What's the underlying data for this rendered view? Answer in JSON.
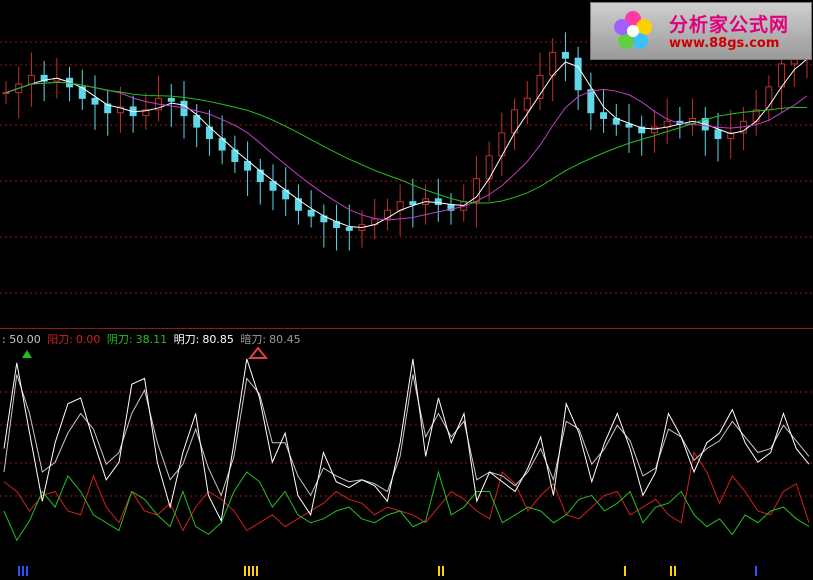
{
  "legend": {
    "value_prefix": ": 50.00",
    "yang_label": "阳刀:",
    "yang_value": "0.00",
    "yin_label": "阴刀:",
    "yin_value": "38.11",
    "ming_label": "明刀:",
    "ming_value": "80.85",
    "an_label": "暗刀:",
    "an_value": "80.45"
  },
  "logo": {
    "title": "分析家公式网",
    "url": "www.88gs.com"
  },
  "colors": {
    "up": "#c03030",
    "down": "#5fd8e8",
    "ma_short": "#ffffff",
    "ma_mid": "#c040c0",
    "ma_long": "#20c020",
    "yang": "#d02020",
    "yin": "#20c020",
    "ming": "#ffffff",
    "an": "#c8c8c8",
    "grid": "#a01010"
  },
  "chart_data": [
    {
      "type": "candlestick",
      "title": "",
      "ylim": [
        0,
        100
      ],
      "series": [
        {
          "name": "",
          "kind": "close",
          "values": [
            74,
            77,
            80,
            78,
            79,
            76,
            72,
            70,
            67,
            69,
            66,
            68,
            72,
            71,
            66,
            62,
            58,
            54,
            50,
            47,
            43,
            40,
            37,
            33,
            31,
            29,
            27,
            26,
            28,
            30,
            33,
            36,
            35,
            37,
            35,
            33,
            36,
            44,
            52,
            60,
            68,
            72,
            80,
            88,
            86,
            75,
            67,
            65,
            63,
            62,
            60,
            62,
            64,
            63,
            65,
            61,
            58,
            60,
            64,
            68,
            76,
            84,
            86,
            87
          ]
        }
      ]
    },
    {
      "type": "line",
      "title": "",
      "ylim": [
        0,
        100
      ],
      "series": [
        {
          "name": "明刀",
          "values": [
            52,
            96,
            60,
            25,
            55,
            75,
            78,
            56,
            36,
            45,
            85,
            88,
            45,
            22,
            50,
            70,
            28,
            15,
            55,
            98,
            78,
            45,
            60,
            28,
            18,
            50,
            35,
            32,
            36,
            33,
            25,
            55,
            98,
            48,
            78,
            55,
            70,
            25,
            40,
            35,
            30,
            42,
            58,
            28,
            75,
            60,
            35,
            55,
            70,
            52,
            28,
            40,
            70,
            58,
            40,
            55,
            60,
            72,
            55,
            45,
            50,
            70,
            52,
            44
          ]
        },
        {
          "name": "暗刀",
          "values": [
            40,
            90,
            70,
            40,
            45,
            60,
            70,
            62,
            44,
            50,
            70,
            82,
            55,
            36,
            44,
            62,
            42,
            28,
            48,
            88,
            80,
            55,
            55,
            38,
            28,
            42,
            38,
            35,
            36,
            34,
            30,
            48,
            90,
            58,
            70,
            58,
            66,
            36,
            40,
            38,
            33,
            40,
            52,
            36,
            66,
            62,
            44,
            52,
            64,
            56,
            38,
            42,
            62,
            58,
            46,
            52,
            56,
            66,
            58,
            50,
            52,
            64,
            56,
            48
          ]
        },
        {
          "name": "阴刀",
          "values": [
            20,
            5,
            15,
            30,
            22,
            38,
            30,
            18,
            14,
            10,
            30,
            26,
            18,
            12,
            30,
            12,
            8,
            14,
            30,
            40,
            35,
            22,
            30,
            18,
            14,
            16,
            20,
            22,
            16,
            14,
            18,
            20,
            12,
            15,
            40,
            18,
            22,
            30,
            30,
            14,
            18,
            22,
            20,
            14,
            18,
            26,
            28,
            20,
            24,
            30,
            14,
            22,
            24,
            30,
            18,
            12,
            16,
            8,
            18,
            14,
            20,
            22,
            16,
            12
          ]
        },
        {
          "name": "阳刀",
          "values": [
            35,
            30,
            20,
            28,
            30,
            20,
            18,
            38,
            22,
            14,
            30,
            20,
            18,
            24,
            10,
            22,
            30,
            26,
            20,
            10,
            14,
            18,
            12,
            16,
            20,
            24,
            30,
            26,
            24,
            18,
            22,
            20,
            18,
            14,
            22,
            30,
            26,
            20,
            16,
            40,
            34,
            20,
            28,
            34,
            18,
            16,
            22,
            28,
            30,
            18,
            22,
            26,
            18,
            14,
            50,
            40,
            24,
            38,
            30,
            20,
            18,
            30,
            34,
            14
          ]
        }
      ],
      "signals": {
        "top_marks": [
          "up",
          "down"
        ],
        "bottom_bar_colors": [
          "blue",
          "yellow",
          "yellow",
          "yellow",
          "yellow",
          "yellow",
          "blue"
        ]
      }
    }
  ]
}
